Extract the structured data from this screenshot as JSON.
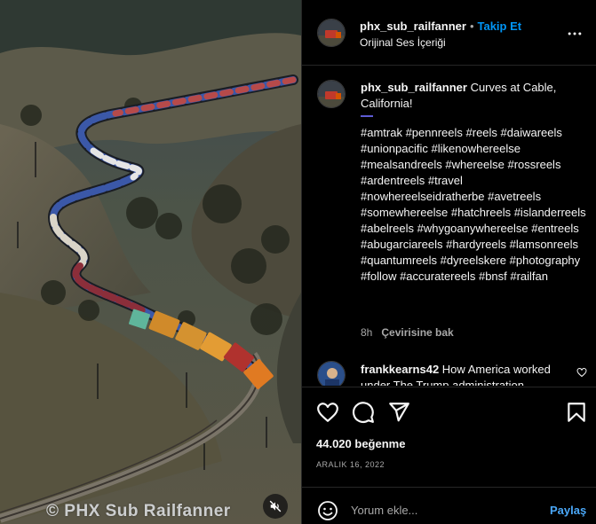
{
  "video": {
    "watermark": "© PHX Sub Railfanner",
    "mute_icon": "speaker-muted-icon"
  },
  "header": {
    "username": "phx_sub_railfanner",
    "separator": "•",
    "follow_label": "Takip Et",
    "audio": "Orijinal Ses İçeriği",
    "more_icon": "more-options-icon"
  },
  "caption": {
    "username": "phx_sub_railfanner",
    "text": "Curves at Cable, California!",
    "hashtags": "#amtrak #pennreels #reels #daiwareels #unionpacific #likenowhereelse #mealsandreels #whereelse #rossreels #ardentreels #travel #nowhereelseidratherbe #avetreels #somewhereelse #hatchreels #islanderreels #abelreels #whygoanywhereelse #entreels #abugarciareels #hardyreels #lamsonreels #quantumreels #dyreelskere #photography #follow #accuratereels #bnsf #railfan",
    "time": "8h",
    "translate": "Çevirisine bak"
  },
  "comments": [
    {
      "username": "frankkearns42",
      "text": "How America worked under The Trump administration"
    }
  ],
  "actions": {
    "like_icon": "heart-icon",
    "comment_icon": "comment-bubble-icon",
    "share_icon": "paper-plane-icon",
    "save_icon": "bookmark-icon",
    "likes": "44.020 beğenme",
    "date": "ARALIK 16, 2022"
  },
  "composer": {
    "emoji_icon": "emoji-icon",
    "placeholder": "Yorum ekle...",
    "post_label": "Paylaş"
  },
  "colors": {
    "background": "#000000",
    "accent": "#0095f6",
    "divider": "#262626",
    "muted_text": "#a8a8a8"
  }
}
